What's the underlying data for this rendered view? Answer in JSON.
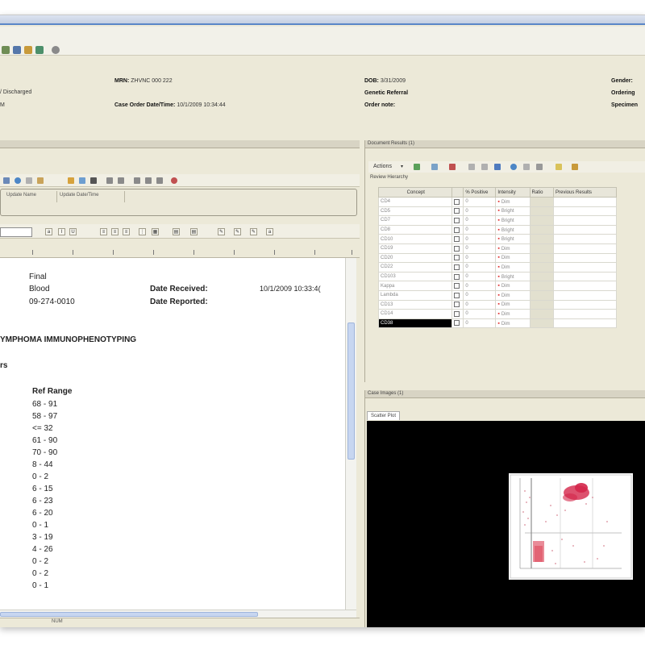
{
  "header": {
    "row1": [
      {
        "label": "",
        "value": "/ Discharged"
      },
      {
        "label": "MRN:",
        "value": "ZHVNC 000 222"
      },
      {
        "label": "DOB:",
        "value": "3/31/2009"
      },
      {
        "label": "Gender:",
        "value": ""
      }
    ],
    "row2": [
      {
        "label": "",
        "value": "M"
      },
      {
        "label": "Case Order Date/Time:",
        "value": "10/1/2009 10:34:44"
      },
      {
        "label": "Genetic Referral",
        "value": ""
      },
      {
        "label": "Ordering",
        "value": ""
      }
    ],
    "row3": [
      {
        "label": "Order note:",
        "value": ""
      },
      {
        "label": "Specimen",
        "value": ""
      }
    ]
  },
  "editor": {
    "tab_labels": [
      "Update Name",
      "Update Date/Time"
    ],
    "lines": [
      {
        "a": "Final",
        "b": "Date Received:",
        "c": "10/1/2009 10:33:4("
      },
      {
        "a": "Blood",
        "b": "Date Reported:",
        "c": ""
      },
      {
        "a": "09-274-0010",
        "b": "",
        "c": ""
      }
    ],
    "heading": "YMPHOMA IMMUNOPHENOTYPING",
    "subheading": "rs",
    "ref_range_label": "Ref Range",
    "ref_ranges": [
      "68 - 91",
      "58 - 97",
      "<= 32",
      "61 - 90",
      "70 - 90",
      "8 - 44",
      "0 - 2",
      "6 - 15",
      "6 - 23",
      "6 - 20",
      "0 - 1",
      "3 - 19",
      "4 - 26",
      "0 - 2",
      "0 - 2",
      "0 - 1"
    ]
  },
  "results": {
    "title": "Document Results (1)",
    "actions_label": "Actions",
    "review_label": "Review Hierarchy",
    "columns": [
      "Concept",
      "",
      "% Positive",
      "Intensity",
      "Ratio",
      "Previous Results"
    ],
    "rows": [
      {
        "concept": "CD4",
        "pos": "0",
        "intensity": "Dim"
      },
      {
        "concept": "CD5",
        "pos": "0",
        "intensity": "Bright"
      },
      {
        "concept": "CD7",
        "pos": "0",
        "intensity": "Bright"
      },
      {
        "concept": "CD8",
        "pos": "0",
        "intensity": "Bright"
      },
      {
        "concept": "CD10",
        "pos": "0",
        "intensity": "Bright"
      },
      {
        "concept": "CD19",
        "pos": "0",
        "intensity": "Dim"
      },
      {
        "concept": "CD20",
        "pos": "0",
        "intensity": "Dim"
      },
      {
        "concept": "CD22",
        "pos": "0",
        "intensity": "Dim"
      },
      {
        "concept": "CD103",
        "pos": "0",
        "intensity": "Bright"
      },
      {
        "concept": "Kappa",
        "pos": "0",
        "intensity": "Dim"
      },
      {
        "concept": "Lambda",
        "pos": "0",
        "intensity": "Dim"
      },
      {
        "concept": "CD13",
        "pos": "0",
        "intensity": "Dim"
      },
      {
        "concept": "CD14",
        "pos": "0",
        "intensity": "Dim"
      },
      {
        "concept": "CD38",
        "pos": "0",
        "intensity": "Dim"
      }
    ]
  },
  "images": {
    "title": "Case Images (1)",
    "tab": "Scatter Plot"
  },
  "statusbar": {
    "mode": "NUM"
  }
}
